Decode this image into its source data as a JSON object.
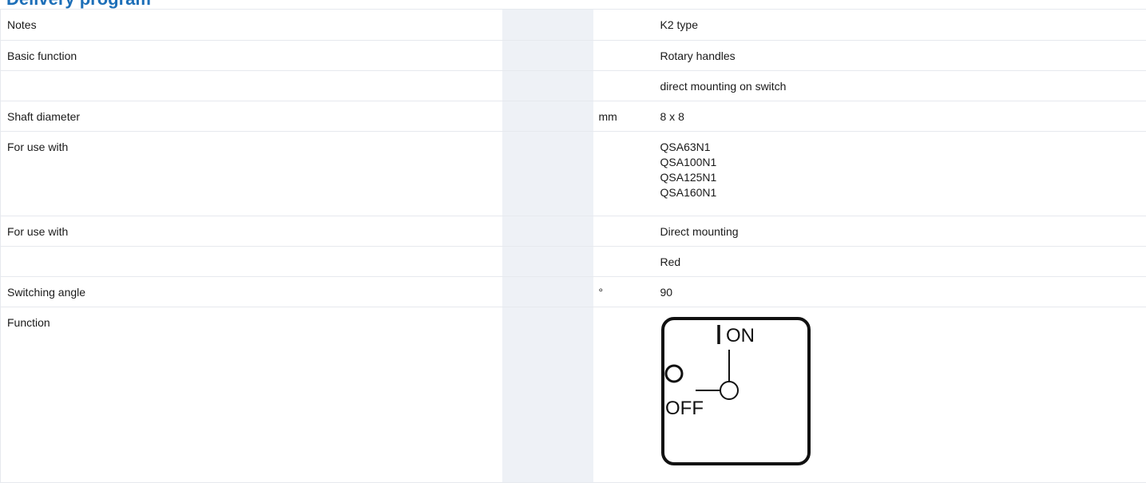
{
  "page": {
    "heading": "Delivery program"
  },
  "rows": [
    {
      "label": "Notes",
      "unit": "",
      "value": [
        "K2 type"
      ]
    },
    {
      "label": "Basic function",
      "unit": "",
      "value": [
        "Rotary handles"
      ]
    },
    {
      "label": "",
      "unit": "",
      "value": [
        "direct mounting on switch"
      ]
    },
    {
      "label": "Shaft diameter",
      "unit": "mm",
      "value": [
        "8 x 8"
      ]
    },
    {
      "label": "For use with",
      "unit": "",
      "value": [
        "QSA63N1",
        "QSA100N1",
        "QSA125N1",
        "QSA160N1"
      ]
    },
    {
      "label": "For use with",
      "unit": "",
      "value": [
        "Direct mounting"
      ]
    },
    {
      "label": "",
      "unit": "",
      "value": [
        "Red"
      ]
    },
    {
      "label": "Switching angle",
      "unit": "°",
      "value": [
        "90"
      ]
    },
    {
      "label": "Function",
      "unit": "",
      "value": []
    }
  ],
  "function_diagram": {
    "on_label": "ON",
    "off_label": "OFF",
    "icon": "switch-position-diagram-icon"
  },
  "colors": {
    "heading": "#1d6fb8",
    "gap_column": "#eef1f6",
    "row_border": "#e6e9ee"
  }
}
